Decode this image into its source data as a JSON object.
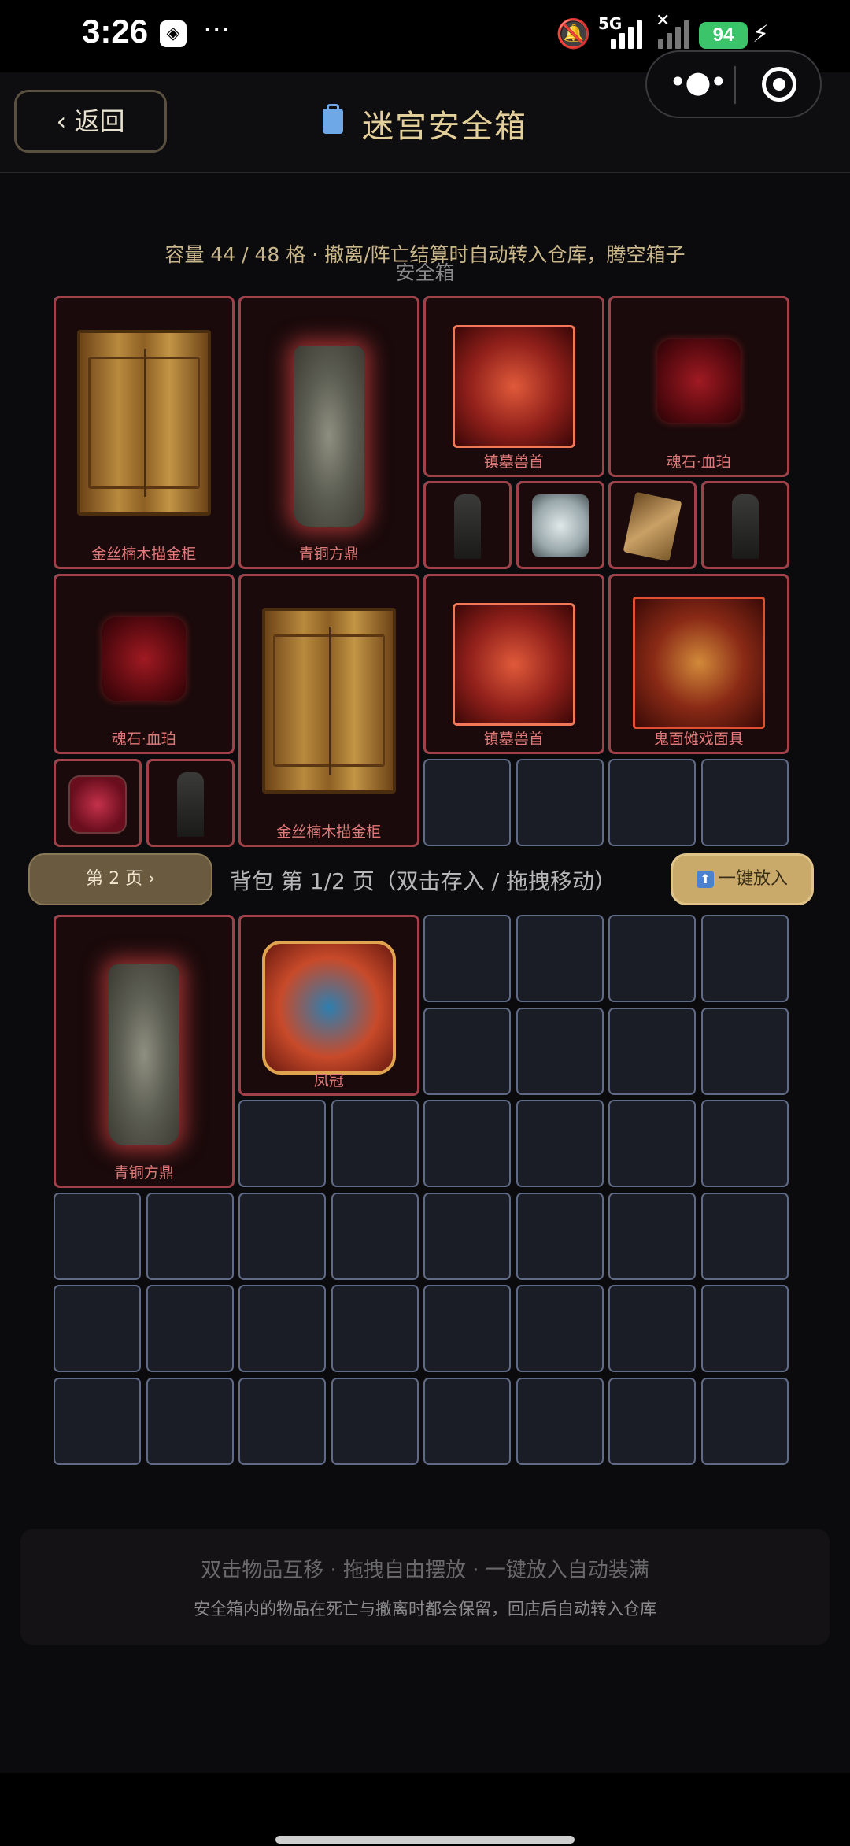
{
  "status_bar": {
    "time": "3:26",
    "more": "···",
    "network": "5G",
    "battery": "94"
  },
  "header": {
    "back_label": "‹ 返回",
    "title": "迷宫安全箱"
  },
  "capacity": {
    "text": "容量 44 / 48 格 · 撤离/阵亡结算时自动转入仓库，腾空箱子",
    "section_label": "安全箱"
  },
  "safebox_items": [
    {
      "label": "金丝楠木描金柜",
      "icon": "cabinet"
    },
    {
      "label": "青铜方鼎",
      "icon": "cauldron"
    },
    {
      "label": "镇墓兽首",
      "icon": "beast-head"
    },
    {
      "label": "魂石·血珀",
      "icon": "blood-amber"
    },
    {
      "label": "",
      "icon": "stele"
    },
    {
      "label": "",
      "icon": "jade-seal"
    },
    {
      "label": "",
      "icon": "scroll"
    },
    {
      "label": "",
      "icon": "stele"
    },
    {
      "label": "魂石·血珀",
      "icon": "blood-amber"
    },
    {
      "label": "金丝楠木描金柜",
      "icon": "cabinet"
    },
    {
      "label": "镇墓兽首",
      "icon": "beast-head"
    },
    {
      "label": "鬼面傩戏面具",
      "icon": "ghost-mask"
    },
    {
      "label": "",
      "icon": "heart"
    },
    {
      "label": "",
      "icon": "stele"
    }
  ],
  "middle_bar": {
    "page_button": "第 2 页 ›",
    "bag_label": "背包 第 1/2 页（双击存入 / 拖拽移动）",
    "fill_button": "一键放入"
  },
  "bag_items": [
    {
      "label": "青铜方鼎",
      "icon": "cauldron"
    },
    {
      "label": "凤冠",
      "icon": "phoenix-crown"
    }
  ],
  "footer": {
    "tip_line1": "双击物品互移 · 拖拽自由摆放 · 一键放入自动装满",
    "tip_line2": "安全箱内的物品在死亡与撤离时都会保留，回店后自动转入仓库"
  },
  "colors": {
    "item_border": "#a04048",
    "cell_border": "#5f6a86",
    "accent_gold": "#e3cf9a"
  }
}
